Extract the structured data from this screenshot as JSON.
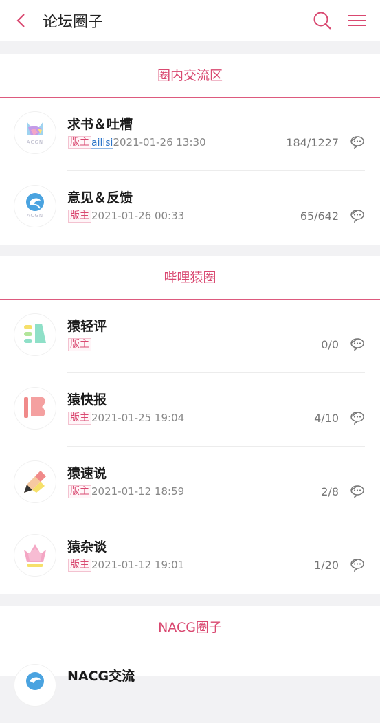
{
  "header": {
    "title": "论坛圈子"
  },
  "colors": {
    "accent": "#d94870",
    "divider": "#dd5a7e",
    "background": "#f2f2f4"
  },
  "sections": [
    {
      "title": "圈内交流区",
      "rows": [
        {
          "name": "求书＆吐槽",
          "badge": "版主",
          "user": "ailisi",
          "time": "2021-01-26 13:30",
          "stats": "184/1227",
          "icon": "acgn-cat-logo"
        },
        {
          "name": "意见＆反馈",
          "badge": "版主",
          "user": "",
          "time": "2021-01-26 00:33",
          "stats": "65/642",
          "icon": "acgn-bird-logo"
        }
      ]
    },
    {
      "title": "哔哩猿圈",
      "rows": [
        {
          "name": "猿轻评",
          "badge": "版主",
          "user": "",
          "time": "",
          "stats": "0/0",
          "icon": "bars-logo"
        },
        {
          "name": "猿快报",
          "badge": "版主",
          "user": "",
          "time": "2021-01-25 19:04",
          "stats": "4/10",
          "icon": "flag-logo"
        },
        {
          "name": "猿速说",
          "badge": "版主",
          "user": "",
          "time": "2021-01-12 18:59",
          "stats": "2/8",
          "icon": "pencil-logo"
        },
        {
          "name": "猿杂谈",
          "badge": "版主",
          "user": "",
          "time": "2021-01-12 19:01",
          "stats": "1/20",
          "icon": "crown-logo"
        }
      ]
    },
    {
      "title": "NACG圈子",
      "rows": [
        {
          "name": "NACG交流",
          "badge": "",
          "user": "",
          "time": "",
          "stats": "",
          "icon": "blue-circle-logo"
        }
      ]
    }
  ]
}
